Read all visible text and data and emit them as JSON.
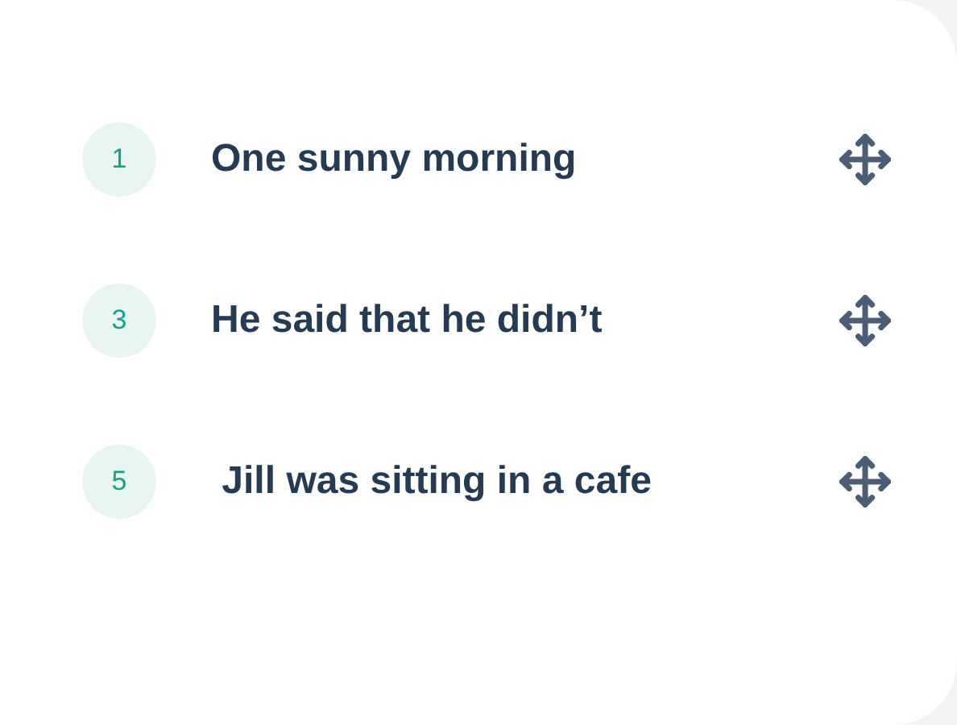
{
  "items": [
    {
      "number": "1",
      "text": "One sunny morning"
    },
    {
      "number": "3",
      "text": "He said that he didn’t"
    },
    {
      "number": "5",
      "text": " Jill was sitting in a cafe"
    }
  ]
}
